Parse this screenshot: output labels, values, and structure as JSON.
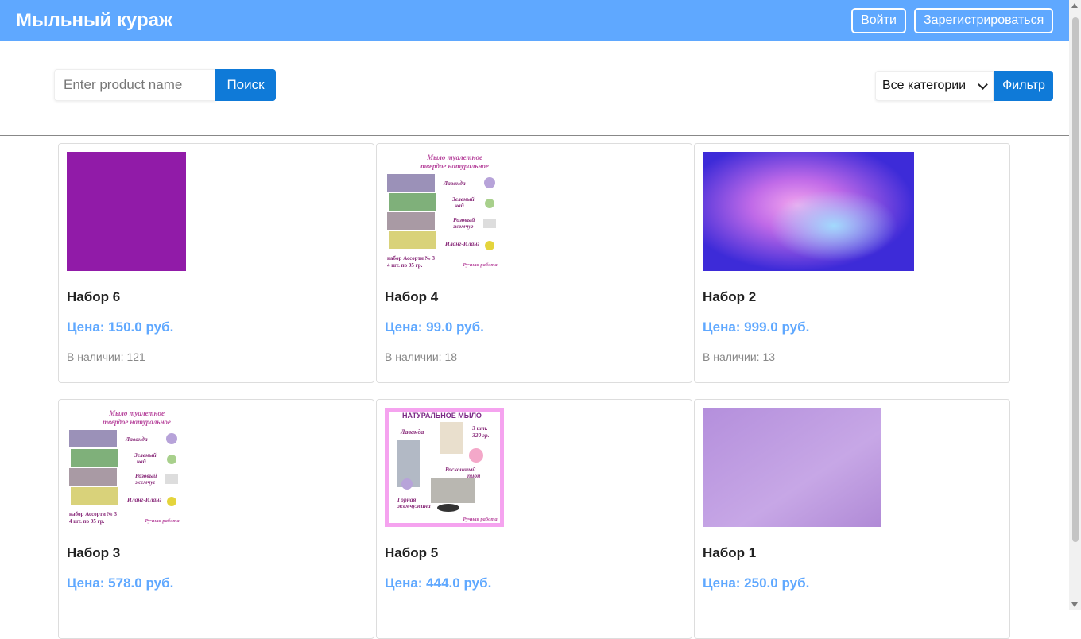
{
  "header": {
    "title": "Мыльный кураж",
    "login_label": "Войти",
    "register_label": "Зарегистрироваться"
  },
  "search": {
    "placeholder": "Enter product name",
    "value": "",
    "button_label": "Поиск"
  },
  "filter": {
    "selected": "Все категории",
    "button_label": "Фильтр"
  },
  "products": [
    {
      "name": "Набор 6",
      "price": "Цена: 150.0 руб.",
      "stock": "В наличии: 121"
    },
    {
      "name": "Набор 4",
      "price": "Цена: 99.0 руб.",
      "stock": "В наличии: 18"
    },
    {
      "name": "Набор 2",
      "price": "Цена: 999.0 руб.",
      "stock": "В наличии: 13"
    },
    {
      "name": "Набор 3",
      "price": "Цена: 578.0 руб.",
      "stock": ""
    },
    {
      "name": "Набор 5",
      "price": "Цена: 444.0 руб.",
      "stock": ""
    },
    {
      "name": "Набор 1",
      "price": "Цена: 250.0 руб.",
      "stock": ""
    }
  ],
  "assorti_image": {
    "title_line1": "Мыло туалетное",
    "title_line2": "твердое натуральное",
    "labels": [
      "Лаванда",
      "Зеленый",
      "чай",
      "Розовый",
      "жемчуг",
      "Иланг-Иланг"
    ],
    "caption_line1": "набор Ассорти № 3",
    "caption_line2": "4 шт. по 95 гр.",
    "signature": "Ручная работа"
  },
  "natural_image": {
    "title": "НАТУРАЛЬНОЕ МЫЛО",
    "lavender": "Лаванда",
    "count_line1": "3 шт.",
    "count_line2": "320 гр.",
    "peony_line1": "Роскошный",
    "peony_line2": "пион",
    "pearl_line1": "Горная",
    "pearl_line2": "жемчужина",
    "signature": "Ручная работа"
  },
  "colors": {
    "header": "#5fa8ff",
    "primary_button": "#0f7ad8",
    "price": "#5fa8ff"
  }
}
